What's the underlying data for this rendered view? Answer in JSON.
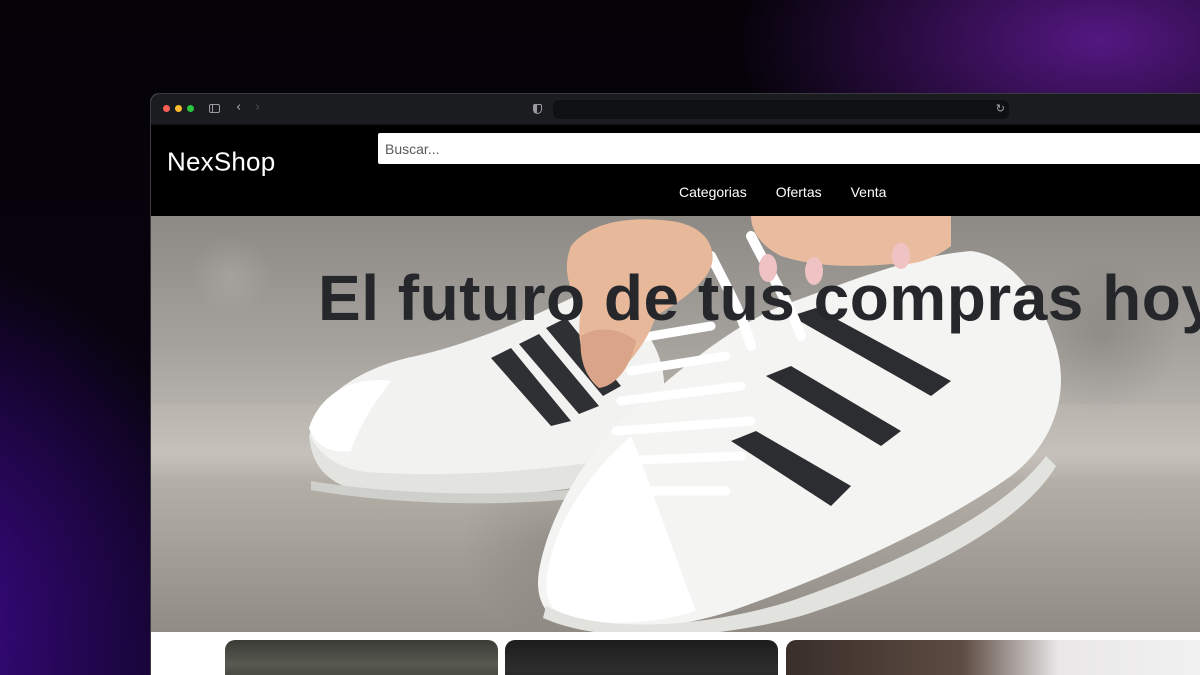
{
  "browser": {
    "url": "",
    "icons": [
      "sidebar-icon",
      "back-arrow-icon",
      "forward-arrow-icon",
      "shield-icon",
      "reload-icon"
    ]
  },
  "site": {
    "logo": "NexShop",
    "search_placeholder": "Buscar...",
    "menu": [
      {
        "label": "Categorias"
      },
      {
        "label": "Ofertas"
      },
      {
        "label": "Venta"
      }
    ]
  },
  "hero": {
    "title": "El futuro de tus compras hoy"
  },
  "colors": {
    "header_bg": "#000000",
    "hero_title": "#25272b",
    "background_accent": "#4a0f8a"
  }
}
